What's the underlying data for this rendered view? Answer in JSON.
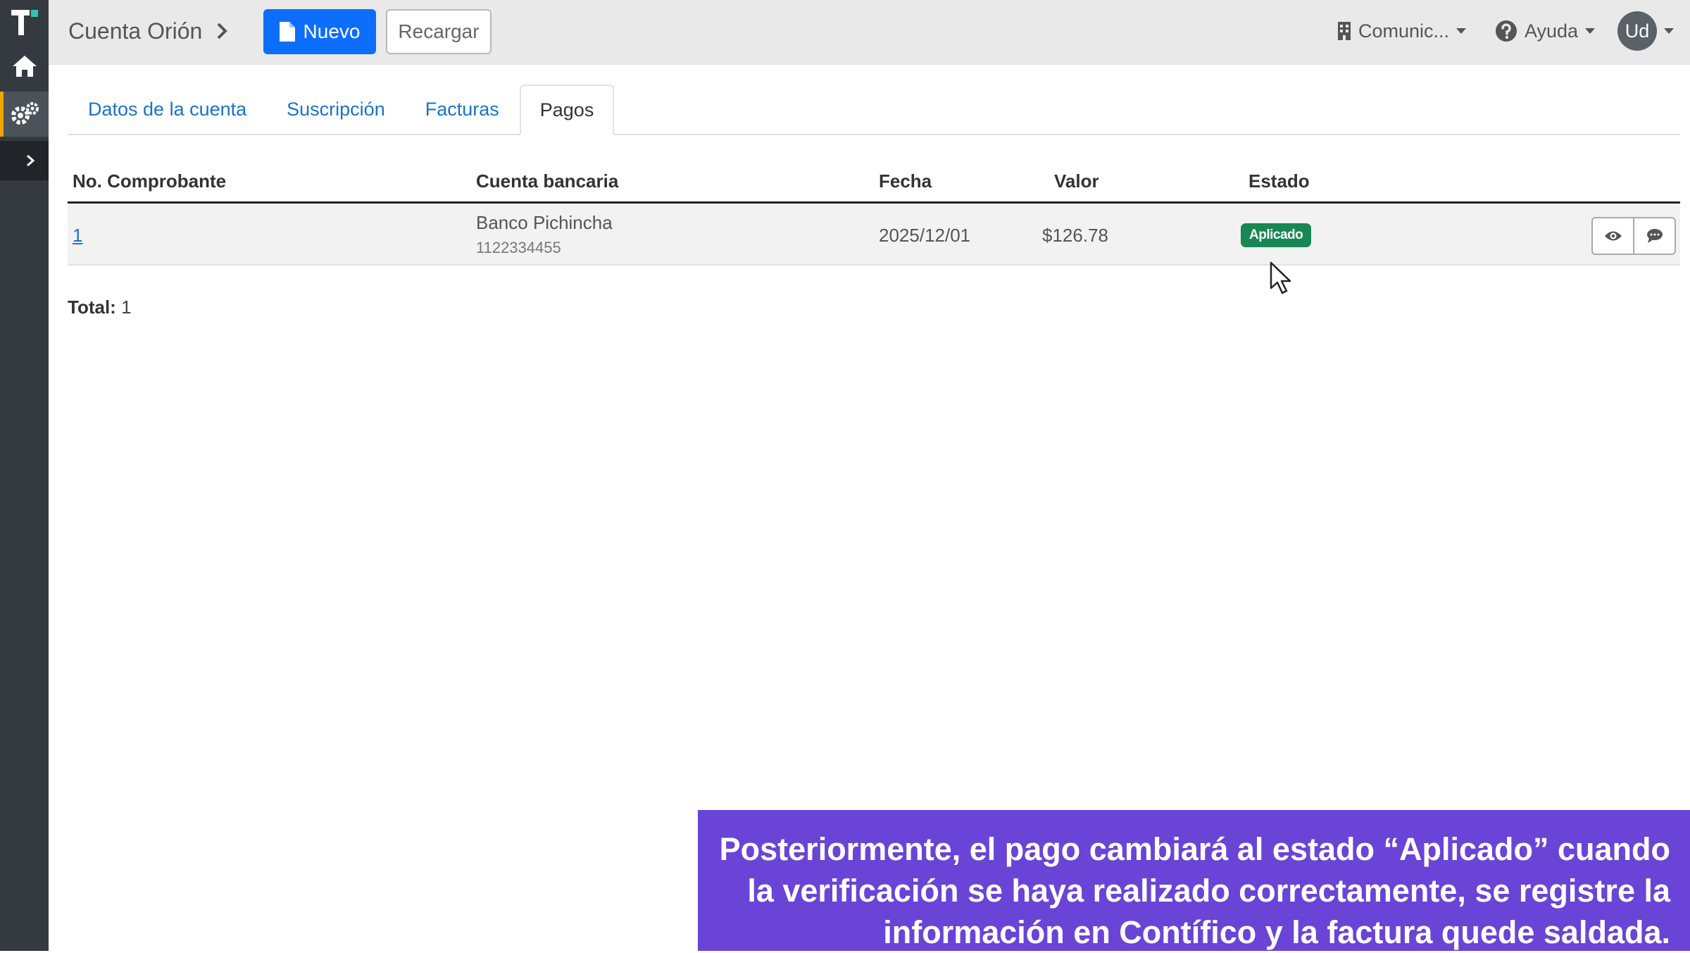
{
  "header": {
    "breadcrumb": "Cuenta Orión",
    "new_label": "Nuevo",
    "reload_label": "Recargar",
    "company_label": "Comunic...",
    "help_label": "Ayuda",
    "user_initials": "Ud"
  },
  "tabs": [
    {
      "label": "Datos de la cuenta"
    },
    {
      "label": "Suscripción"
    },
    {
      "label": "Facturas"
    },
    {
      "label": "Pagos",
      "active": true
    }
  ],
  "table": {
    "columns": [
      "No. Comprobante",
      "Cuenta bancaria",
      "Fecha",
      "Valor",
      "Estado"
    ],
    "rows": [
      {
        "comprobante": "1",
        "banco": "Banco Pichincha",
        "cuenta": "1122334455",
        "fecha": "2025/12/01",
        "valor": "$126.78",
        "estado": "Aplicado"
      }
    ]
  },
  "footer": {
    "total_label": "Total:",
    "total_value": "1"
  },
  "caption": {
    "text": "Posteriormente, el pago cambiará al estado “Aplicado” cuando la verificación se haya realizado correctamente, se registre la información en Contífico y la factura quede saldada."
  },
  "colors": {
    "primary": "#0d6efd",
    "success": "#198754",
    "sidebar": "#343a40",
    "caption_bg": "#6a44d6",
    "link": "#1a73c9"
  },
  "icons": {
    "logo": "brand-logo-icon",
    "home": "home-icon",
    "config": "gears-icon",
    "expand": "chevron-right-icon",
    "new": "document-icon",
    "company": "building-icon",
    "help": "question-circle-icon",
    "view": "eye-icon",
    "comment": "comment-icon"
  }
}
